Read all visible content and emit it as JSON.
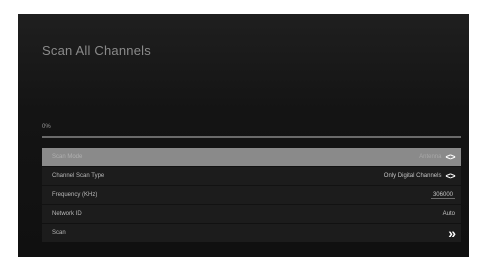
{
  "screen": {
    "title": "Scan All Channels",
    "progress": {
      "label": "0%",
      "percent": 0
    }
  },
  "menu": {
    "items": [
      {
        "label": "Scan Mode",
        "value": "Antenna",
        "control": "left-right-arrows"
      },
      {
        "label": "Channel Scan Type",
        "value": "Only Digital Channels",
        "control": "left-right-arrows"
      },
      {
        "label": "Frequency (KHz)",
        "value": "306000",
        "control": "text-field"
      },
      {
        "label": "Network ID",
        "value": "Auto",
        "control": "none"
      },
      {
        "label": "Scan",
        "value": "",
        "control": "double-chevron"
      }
    ],
    "selected_index": 0
  },
  "icons": {
    "left_right_arrows": "<>",
    "double_chevron": "»"
  },
  "colors": {
    "background": "#141414",
    "selected_row": "#8a8a8a",
    "text": "#b8b8b8",
    "accent": "#ffffff"
  }
}
